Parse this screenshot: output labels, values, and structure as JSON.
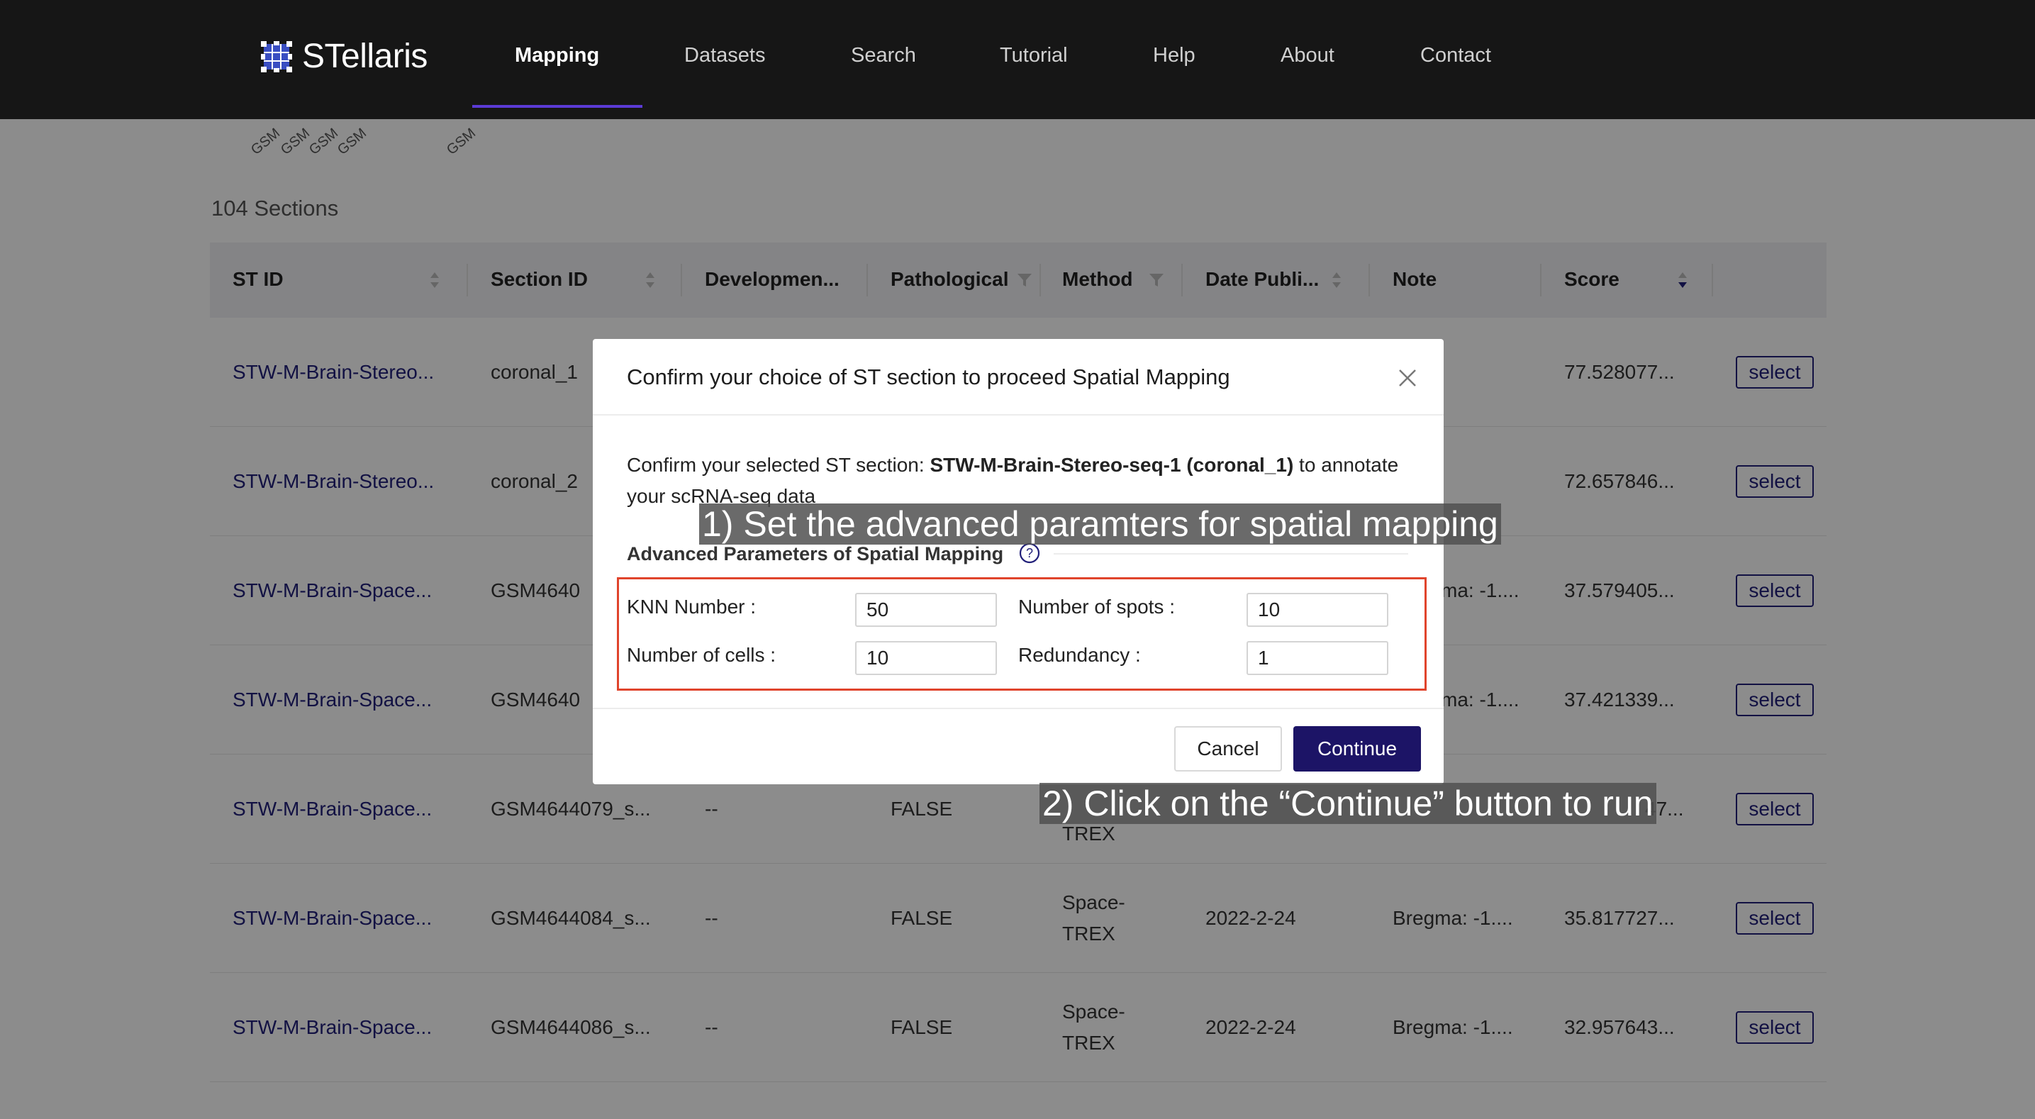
{
  "nav": {
    "logo_text": "STellaris",
    "items": [
      "Mapping",
      "Datasets",
      "Search",
      "Tutorial",
      "Help",
      "About",
      "Contact"
    ],
    "active": "Mapping",
    "accent": "#5b3bd6"
  },
  "plot_labels": [
    "GSM",
    "GSM",
    "GSM",
    "GSM",
    "GSM"
  ],
  "sections_count": "104 Sections",
  "table": {
    "headers": [
      "ST ID",
      "Section ID",
      "Developmen...",
      "Pathological",
      "Method",
      "Date Publi...",
      "Note",
      "Score"
    ],
    "select_label": "select",
    "rows": [
      {
        "st_id": "STW-M-Brain-Stereo...",
        "section_id": "coronal_1",
        "development": "",
        "pathological": "",
        "method": [
          "",
          ""
        ],
        "date": "",
        "note": "",
        "score": "77.528077..."
      },
      {
        "st_id": "STW-M-Brain-Stereo...",
        "section_id": "coronal_2",
        "development": "",
        "pathological": "",
        "method": [
          "",
          ""
        ],
        "date": "",
        "note": "",
        "score": "72.657846..."
      },
      {
        "st_id": "STW-M-Brain-Space...",
        "section_id": "GSM4640",
        "development": "",
        "pathological": "",
        "method": [
          "",
          ""
        ],
        "date": "",
        "note": "ma: -1....",
        "score": "37.579405..."
      },
      {
        "st_id": "STW-M-Brain-Space...",
        "section_id": "GSM4640",
        "development": "",
        "pathological": "",
        "method": [
          "",
          ""
        ],
        "date": "",
        "note": "ma: -1....",
        "score": "37.421339..."
      },
      {
        "st_id": "STW-M-Brain-Space...",
        "section_id": "GSM4644079_s...",
        "development": "--",
        "pathological": "FALSE",
        "method": [
          "",
          "TREX"
        ],
        "date": "",
        "note": "",
        "score": "47..."
      },
      {
        "st_id": "STW-M-Brain-Space...",
        "section_id": "GSM4644084_s...",
        "development": "--",
        "pathological": "FALSE",
        "method": [
          "Space-",
          "TREX"
        ],
        "date": "2022-2-24",
        "note": "Bregma: -1....",
        "score": "35.817727..."
      },
      {
        "st_id": "STW-M-Brain-Space...",
        "section_id": "GSM4644086_s...",
        "development": "--",
        "pathological": "FALSE",
        "method": [
          "Space-",
          "TREX"
        ],
        "date": "2022-2-24",
        "note": "Bregma: -1....",
        "score": "32.957643..."
      }
    ]
  },
  "modal": {
    "title": "Confirm your choice of ST section to proceed Spatial Mapping",
    "confirm_prefix": "Confirm your selected ST section: ",
    "confirm_section": "STW-M-Brain-Stereo-seq-1 (coronal_1)",
    "confirm_suffix": " to annotate your scRNA-seq data",
    "advanced_title": "Advanced Parameters of Spatial Mapping",
    "params": {
      "knn_label": "KNN Number :",
      "knn_value": "50",
      "spots_label": "Number of spots :",
      "spots_value": "10",
      "cells_label": "Number of cells :",
      "cells_value": "10",
      "redundancy_label": "Redundancy :",
      "redundancy_value": "1"
    },
    "cancel_label": "Cancel",
    "continue_label": "Continue",
    "continue_color": "#1c1466"
  },
  "annotations": {
    "step1": "1) Set the advanced paramters for spatial mapping",
    "step2": "2) Click on the “Continue” button to run"
  }
}
